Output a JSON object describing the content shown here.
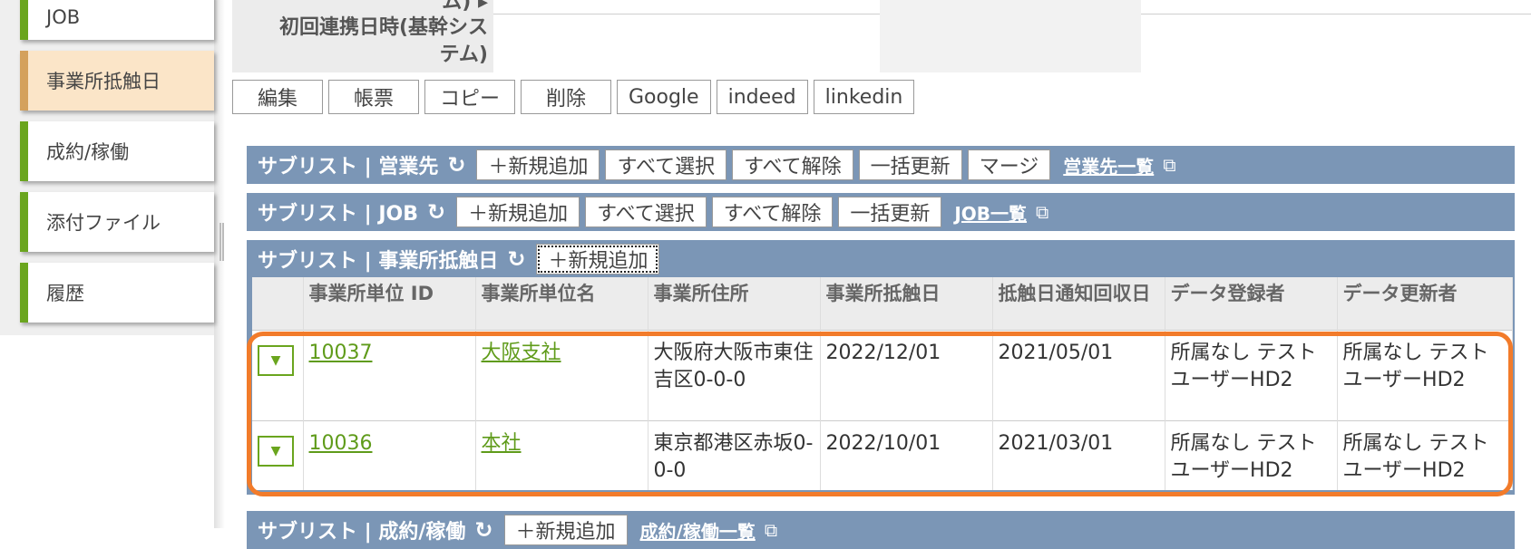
{
  "sidebar": {
    "items": [
      {
        "label": "JOB"
      },
      {
        "label": "事業所抵触日"
      },
      {
        "label": "成約/稼働"
      },
      {
        "label": "添付ファイル"
      },
      {
        "label": "履歴"
      }
    ]
  },
  "detail": {
    "cut_label": "ム)",
    "first_link_label_line1": "初回連携日時(基幹シス",
    "first_link_label_line2": "テム)"
  },
  "record_buttons": [
    "編集",
    "帳票",
    "コピー",
    "削除",
    "Google",
    "indeed",
    "linkedin"
  ],
  "sublists": {
    "customer": {
      "title": "サブリスト | 営業先",
      "buttons": [
        "＋新規追加",
        "すべて選択",
        "すべて解除",
        "一括更新",
        "マージ"
      ],
      "link": "営業先一覧"
    },
    "job": {
      "title": "サブリスト | JOB",
      "buttons": [
        "＋新規追加",
        "すべて選択",
        "すべて解除",
        "一括更新"
      ],
      "link": "JOB一覧"
    },
    "office": {
      "title": "サブリスト | 事業所抵触日",
      "buttons": [
        "＋新規追加"
      ],
      "columns": [
        "",
        "事業所単位 ID",
        "事業所単位名",
        "事業所住所",
        "事業所抵触日",
        "抵触日通知回収日",
        "データ登録者",
        "データ更新者"
      ],
      "rows": [
        {
          "id": "10037",
          "name": "大阪支社",
          "address": "大阪府大阪市東住吉区0-0-0",
          "conflict_date": "2022/12/01",
          "notice_date": "2021/05/01",
          "created_by": "所属なし テストユーザーHD2",
          "updated_by": "所属なし テストユーザーHD2"
        },
        {
          "id": "10036",
          "name": "本社",
          "address": "東京都港区赤坂0-0-0",
          "conflict_date": "2022/10/01",
          "notice_date": "2021/03/01",
          "created_by": "所属なし テストユーザーHD2",
          "updated_by": "所属なし テストユーザーHD2"
        }
      ]
    },
    "contract": {
      "title": "サブリスト | 成約/稼働",
      "buttons": [
        "＋新規追加"
      ],
      "link": "成約/稼働一覧"
    }
  },
  "colors": {
    "bar": "#7b96b6",
    "accent_green": "#6aa51e",
    "highlight": "#f27b2a",
    "active_tab": "#fbe5c8"
  }
}
